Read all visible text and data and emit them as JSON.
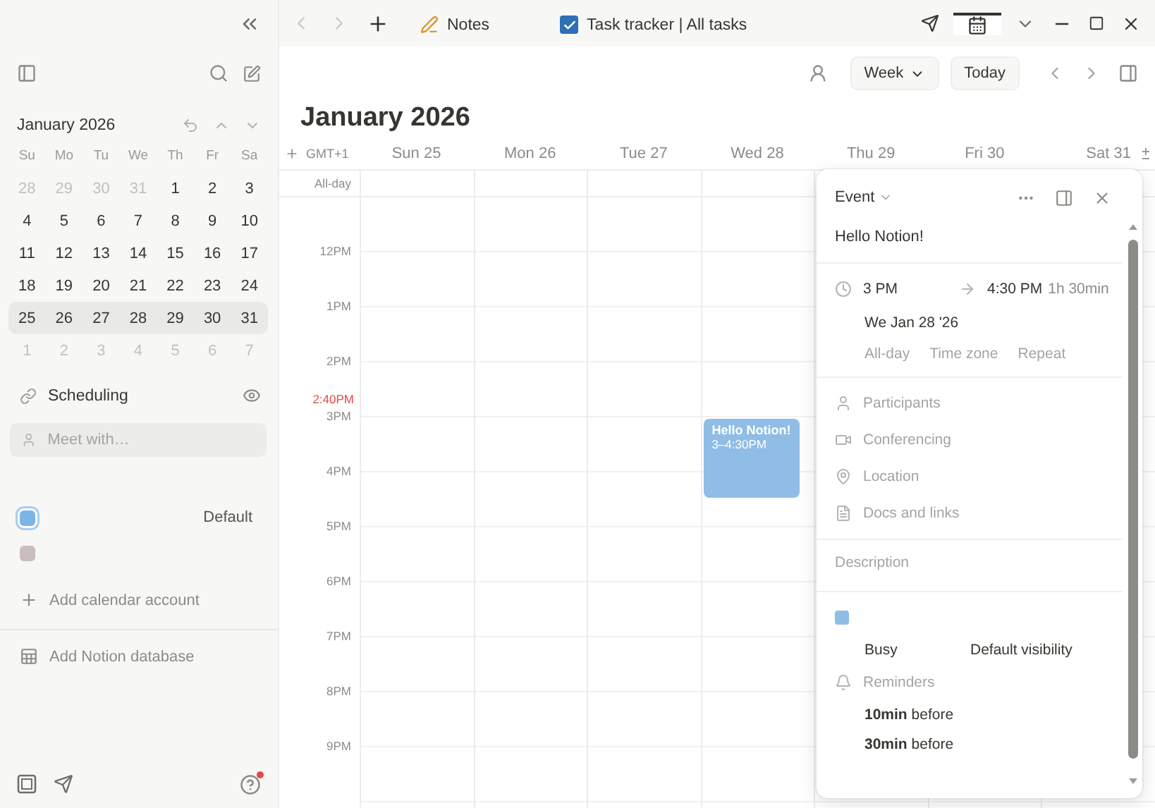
{
  "title_bar": {
    "tabs": [
      {
        "kind": "notes",
        "label": "Notes",
        "selected": false
      },
      {
        "kind": "task",
        "label": "Task tracker | All tasks",
        "selected": false
      },
      {
        "kind": "calendar",
        "selected": true
      }
    ]
  },
  "sidebar": {
    "mini_calendar": {
      "title": "January 2026",
      "weekdays": [
        "Su",
        "Mo",
        "Tu",
        "We",
        "Th",
        "Fr",
        "Sa"
      ],
      "weeks": [
        {
          "selected": false,
          "days": [
            {
              "label": "28",
              "outside": true
            },
            {
              "label": "29",
              "outside": true
            },
            {
              "label": "30",
              "outside": true
            },
            {
              "label": "31",
              "outside": true
            },
            {
              "label": "1",
              "outside": false
            },
            {
              "label": "2",
              "outside": false
            },
            {
              "label": "3",
              "outside": false
            }
          ]
        },
        {
          "selected": false,
          "days": [
            {
              "label": "4",
              "outside": false
            },
            {
              "label": "5",
              "outside": false
            },
            {
              "label": "6",
              "outside": false
            },
            {
              "label": "7",
              "outside": false
            },
            {
              "label": "8",
              "outside": false
            },
            {
              "label": "9",
              "outside": false
            },
            {
              "label": "10",
              "outside": false
            }
          ]
        },
        {
          "selected": false,
          "days": [
            {
              "label": "11",
              "outside": false
            },
            {
              "label": "12",
              "outside": false
            },
            {
              "label": "13",
              "outside": false
            },
            {
              "label": "14",
              "outside": false
            },
            {
              "label": "15",
              "outside": false
            },
            {
              "label": "16",
              "outside": false
            },
            {
              "label": "17",
              "outside": false
            }
          ]
        },
        {
          "selected": false,
          "days": [
            {
              "label": "18",
              "outside": false
            },
            {
              "label": "19",
              "outside": false
            },
            {
              "label": "20",
              "outside": false
            },
            {
              "label": "21",
              "outside": false
            },
            {
              "label": "22",
              "outside": false
            },
            {
              "label": "23",
              "outside": false
            },
            {
              "label": "24",
              "outside": false
            }
          ]
        },
        {
          "selected": true,
          "days": [
            {
              "label": "25",
              "outside": false
            },
            {
              "label": "26",
              "outside": false
            },
            {
              "label": "27",
              "outside": false
            },
            {
              "label": "28",
              "outside": false
            },
            {
              "label": "29",
              "outside": false
            },
            {
              "label": "30",
              "outside": false
            },
            {
              "label": "31",
              "outside": false
            }
          ]
        },
        {
          "selected": false,
          "days": [
            {
              "label": "1",
              "outside": true
            },
            {
              "label": "2",
              "outside": true
            },
            {
              "label": "3",
              "outside": true
            },
            {
              "label": "4",
              "outside": true
            },
            {
              "label": "5",
              "outside": true
            },
            {
              "label": "6",
              "outside": true
            },
            {
              "label": "7",
              "outside": true
            }
          ]
        }
      ]
    },
    "scheduling": {
      "label": "Scheduling"
    },
    "meet_field": {
      "placeholder": "Meet with…"
    },
    "calendars": [
      {
        "color": "#7db4e6",
        "selected": true,
        "label": "Default"
      },
      {
        "color": "#cbbdbd",
        "selected": false
      }
    ],
    "add_account": "Add calendar account",
    "add_database": "Add Notion database",
    "help_notification": true
  },
  "toolbar": {
    "view": "Week",
    "today": "Today"
  },
  "week": {
    "title": "January 2026",
    "timezone": "GMT+1",
    "all_day": "All-day",
    "now": "2:40PM",
    "days": [
      {
        "label": "Sun 25"
      },
      {
        "label": "Mon 26"
      },
      {
        "label": "Tue 27"
      },
      {
        "label": "Wed 28",
        "events": [
          {
            "title": "Hello Notion!",
            "time": "3–4:30PM",
            "color": "#8fbde6"
          }
        ]
      },
      {
        "label": "Thu 29"
      },
      {
        "label": "Fri 30"
      },
      {
        "label": "Sat 31"
      }
    ],
    "hours": [
      "12PM",
      "1PM",
      "2PM",
      "3PM",
      "4PM",
      "5PM",
      "6PM",
      "7PM",
      "8PM",
      "9PM"
    ]
  },
  "event_panel": {
    "type": "Event",
    "title": "Hello Notion!",
    "start": "3 PM",
    "end": "4:30 PM",
    "duration": "1h 30min",
    "date": "We Jan 28 '26",
    "options": [
      "All-day",
      "Time zone",
      "Repeat"
    ],
    "fields": [
      {
        "kind": "participants",
        "label": "Participants"
      },
      {
        "kind": "conferencing",
        "label": "Conferencing"
      },
      {
        "kind": "location",
        "label": "Location"
      },
      {
        "kind": "docs",
        "label": "Docs and links"
      }
    ],
    "description": {
      "placeholder": "Description"
    },
    "color": "#8fbde6",
    "busy": "Busy",
    "visibility": "Default visibility",
    "reminders_label": "Reminders",
    "reminders": [
      {
        "amount": "10min",
        "text": "before"
      },
      {
        "amount": "30min",
        "text": "before"
      }
    ]
  }
}
